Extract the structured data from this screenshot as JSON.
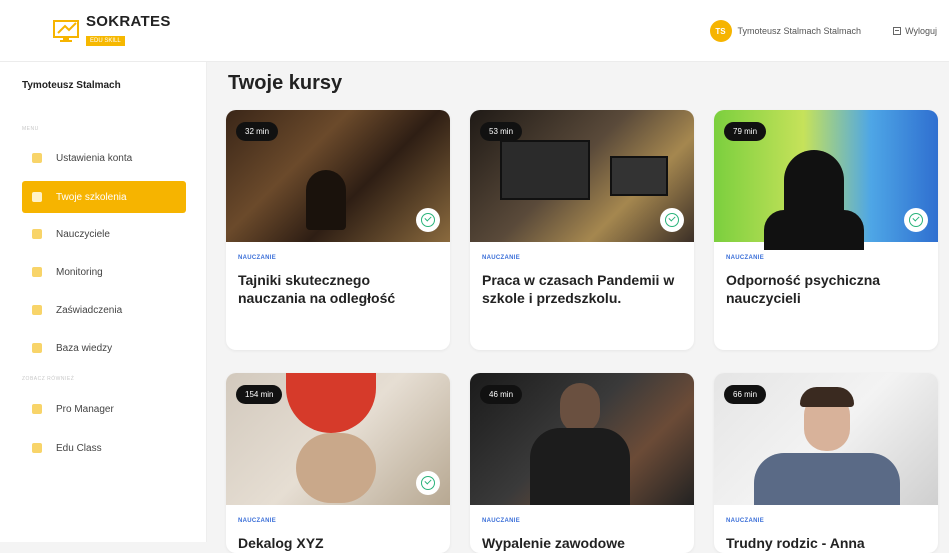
{
  "app": {
    "logo_title": "SOKRATES",
    "logo_sub": "EDU SKILL"
  },
  "header": {
    "avatar_initials": "TS",
    "user_name": "Tymoteusz Stalmach Stalmach",
    "logout_label": "Wyloguj"
  },
  "sidebar": {
    "user": "Tymoteusz Stalmach",
    "section_menu": "MENU",
    "section_other": "ZOBACZ RÓWNIEŻ",
    "items": [
      {
        "label": "Ustawienia konta",
        "icon": "gear-icon",
        "active": false
      },
      {
        "label": "Twoje szkolenia",
        "icon": "book-icon",
        "active": true
      },
      {
        "label": "Nauczyciele",
        "icon": "users-icon",
        "active": false
      },
      {
        "label": "Monitoring",
        "icon": "monitor-icon",
        "active": false
      },
      {
        "label": "Zaświadczenia",
        "icon": "certificate-icon",
        "active": false
      },
      {
        "label": "Baza wiedzy",
        "icon": "folder-icon",
        "active": false
      },
      {
        "label": "Pro Manager",
        "icon": "briefcase-icon",
        "active": false
      },
      {
        "label": "Edu Class",
        "icon": "shield-icon",
        "active": false
      }
    ]
  },
  "main": {
    "title": "Twoje kursy",
    "courses": [
      {
        "duration": "32 min",
        "category": "NAUCZANIE",
        "title": "Tajniki skutecznego nauczania na odległość",
        "completed": true
      },
      {
        "duration": "53 min",
        "category": "NAUCZANIE",
        "title": "Praca w czasach Pandemii w szkole i przedszkolu.",
        "completed": true
      },
      {
        "duration": "79 min",
        "category": "NAUCZANIE",
        "title": "Odporność psychiczna nauczycieli",
        "completed": true
      },
      {
        "duration": "154 min",
        "category": "NAUCZANIE",
        "title": "Dekalog XYZ",
        "completed": true
      },
      {
        "duration": "46 min",
        "category": "NAUCZANIE",
        "title": "Wypalenie zawodowe",
        "completed": false
      },
      {
        "duration": "66 min",
        "category": "NAUCZANIE",
        "title": "Trudny rodzic - Anna",
        "completed": false
      }
    ]
  },
  "colors": {
    "accent": "#f6b400",
    "category": "#3b6fd8",
    "check": "#29b37a"
  }
}
